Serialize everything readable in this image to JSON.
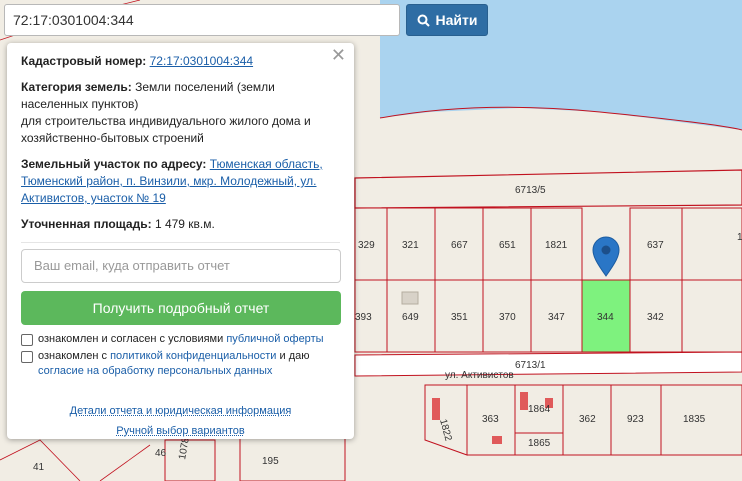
{
  "search": {
    "value": "72:17:0301004:344",
    "button_label": "Найти"
  },
  "panel": {
    "cadastral_label": "Кадастровый номер:",
    "cadastral_value": "72:17:0301004:344",
    "category_label": "Категория земель:",
    "category_value": "Земли поселений (земли населенных пунктов)",
    "purpose": "для строительства индивидуального жилого дома и хозяйственно-бытовых строений",
    "address_label": "Земельный участок по адресу:",
    "address_value": "Тюменская область, Тюменский район, п. Винзили, мкр. Молодежный, ул. Активистов, участок № 19",
    "area_label": "Уточненная площадь:",
    "area_value": "1 479 кв.м.",
    "email_placeholder": "Ваш email, куда отправить отчет",
    "report_button": "Получить подробный отчет",
    "consent1_text": "ознакомлен и согласен с условиями",
    "consent1_link": "публичной оферты",
    "consent2_text": "ознакомлен с",
    "consent2_link1": "политикой конфиденциальности",
    "consent2_middle": "и даю",
    "consent2_link2": "согласие на обработку персональных данных",
    "details_link": "Детали отчета и юридическая информация",
    "manual_link": "Ручной выбор вариантов",
    "close_icon": "close-icon"
  },
  "map": {
    "marker_icon": "map-pin-icon",
    "block_top_label": "6713/5",
    "block_bottom_label": "6713/1",
    "street_label": "ул. Активистов",
    "top_row_parcels": [
      "329",
      "321",
      "667",
      "651",
      "1821",
      "637",
      "1"
    ],
    "bottom_row_parcels": [
      "393",
      "649",
      "351",
      "370",
      "347",
      "344",
      "342"
    ],
    "lower_parcels": [
      "1822",
      "363",
      "1864",
      "1865",
      "362",
      "923",
      "1835",
      "195",
      "1078",
      "41",
      "46"
    ],
    "selected_parcel": "344",
    "selected_color": "#7ef27e",
    "water_color": "#aad3ef",
    "boundary_color": "#c1121f"
  }
}
